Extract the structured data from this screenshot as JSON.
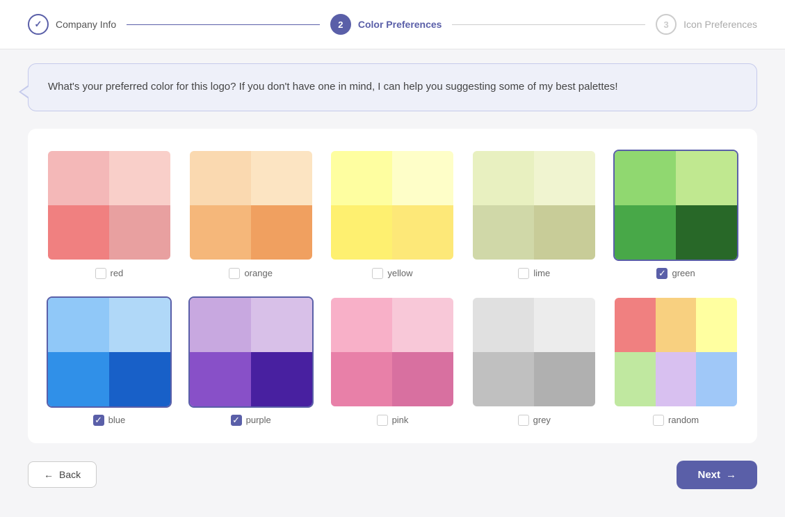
{
  "stepper": {
    "steps": [
      {
        "id": "company-info",
        "number": "✓",
        "label": "Company Info",
        "state": "completed"
      },
      {
        "id": "color-preferences",
        "number": "2",
        "label": "Color Preferences",
        "state": "active"
      },
      {
        "id": "icon-preferences",
        "number": "3",
        "label": "Icon Preferences",
        "state": "inactive"
      }
    ]
  },
  "chat": {
    "message": "What's your preferred color for this logo? If you don't have one in mind, I can help you suggesting some of my best palettes!"
  },
  "palettes": [
    {
      "id": "red",
      "label": "red",
      "checked": false,
      "colors": [
        "#f4b8b8",
        "#f9cfc9",
        "#f08080",
        "#e8a0a0"
      ]
    },
    {
      "id": "orange",
      "label": "orange",
      "checked": false,
      "colors": [
        "#fad9b0",
        "#fce4c2",
        "#f5b77a",
        "#f0a060"
      ]
    },
    {
      "id": "yellow",
      "label": "yellow",
      "checked": false,
      "colors": [
        "#fefea0",
        "#fefec8",
        "#fef070",
        "#fde878"
      ]
    },
    {
      "id": "lime",
      "label": "lime",
      "checked": false,
      "colors": [
        "#e8f0c0",
        "#f0f4d0",
        "#d0d8a8",
        "#c8cc98"
      ]
    },
    {
      "id": "green",
      "label": "green",
      "checked": true,
      "colors": [
        "#90d890",
        "#c0e8a0",
        "#48a848",
        "#286028"
      ]
    },
    {
      "id": "blue",
      "label": "blue",
      "checked": true,
      "colors": [
        "#90c8f8",
        "#b0d8f8",
        "#3090e8",
        "#1860c8"
      ]
    },
    {
      "id": "purple",
      "label": "purple",
      "checked": true,
      "colors": [
        "#c8a8e0",
        "#d8c0e8",
        "#8850c8",
        "#4820a0"
      ]
    },
    {
      "id": "pink",
      "label": "pink",
      "checked": false,
      "colors": [
        "#f8b0c8",
        "#f8c8d8",
        "#e880a8",
        "#d870a0"
      ]
    },
    {
      "id": "grey",
      "label": "grey",
      "checked": false,
      "colors": [
        "#e0e0e0",
        "#ececec",
        "#c0c0c0",
        "#b0b0b0"
      ]
    },
    {
      "id": "random",
      "label": "random",
      "checked": false,
      "colors": [
        "#f08080",
        "#f8d080",
        "#d0f080",
        "#80c8f8"
      ]
    }
  ],
  "random_extra_colors": [
    "#c0e8a0",
    "#d8c0f0",
    "#f0b8c0"
  ],
  "footer": {
    "back_label": "Back",
    "next_label": "Next"
  }
}
